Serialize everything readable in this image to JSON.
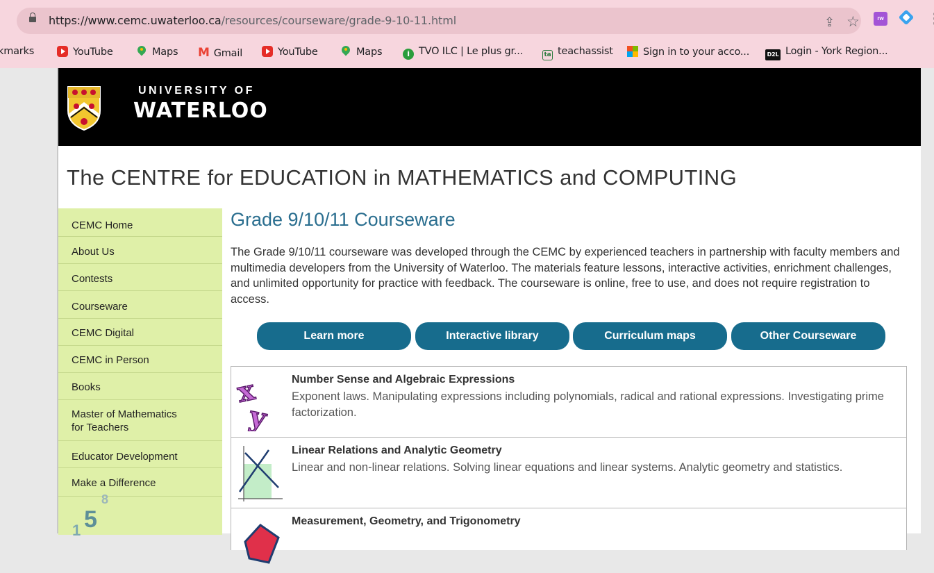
{
  "browser": {
    "url_main": "https://www.cemc.uwaterloo.ca",
    "url_rest": "/resources/courseware/grade-9-10-11.html",
    "bookmarks": [
      {
        "label": "kmarks",
        "icon": "none"
      },
      {
        "label": "YouTube",
        "icon": "youtube-icon"
      },
      {
        "label": "Maps",
        "icon": "maps-icon"
      },
      {
        "label": "Gmail",
        "icon": "gmail-icon"
      },
      {
        "label": "YouTube",
        "icon": "youtube-icon"
      },
      {
        "label": "Maps",
        "icon": "maps-icon"
      },
      {
        "label": "TVO ILC | Le plus gr...",
        "icon": "tvo-icon"
      },
      {
        "label": "teachassist",
        "icon": "teachassist-icon"
      },
      {
        "label": "Sign in to your acco...",
        "icon": "microsoft-icon"
      },
      {
        "label": "Login - York Region...",
        "icon": "d2l-icon"
      }
    ],
    "icons": {
      "gmail_glyph": "M",
      "tvo_glyph": "i",
      "ta_glyph": "ta",
      "d2l_glyph": "D2L",
      "ext_glyph": "rw"
    }
  },
  "banner": {
    "university_of": "UNIVERSITY OF",
    "waterloo": "WATERLOO"
  },
  "site_title": "The CENTRE for EDUCATION in MATHEMATICS and COMPUTING",
  "sidebar": {
    "items": [
      {
        "label": "CEMC Home"
      },
      {
        "label": "About Us"
      },
      {
        "label": "Contests"
      },
      {
        "label": "Courseware"
      },
      {
        "label": "CEMC Digital"
      },
      {
        "label": "CEMC in Person"
      },
      {
        "label": "Books"
      },
      {
        "label": "Master of Mathematics\nfor Teachers"
      },
      {
        "label": "Educator Development"
      },
      {
        "label": "Make a Difference"
      }
    ]
  },
  "main": {
    "title": "Grade 9/10/11 Courseware",
    "intro": "The Grade 9/10/11 courseware was developed through the CEMC by experienced teachers in partnership with faculty members and multimedia developers from the University of Waterloo. The materials feature lessons, interactive activities, enrichment challenges, and unlimited opportunity for practice with feedback. The courseware is online, free to use, and does not require registration to access.",
    "buttons": [
      {
        "label": "Learn more"
      },
      {
        "label": "Interactive library"
      },
      {
        "label": "Curriculum maps"
      },
      {
        "label": "Other Courseware"
      }
    ],
    "sections": [
      {
        "title": "Number Sense and Algebraic Expressions",
        "desc": "Exponent laws. Manipulating expressions including polynomials, radical and rational expressions. Investigating prime factorization."
      },
      {
        "title": "Linear Relations and Analytic Geometry",
        "desc": "Linear and non-linear relations. Solving linear equations and linear systems. Analytic geometry and statistics."
      },
      {
        "title": "Measurement, Geometry, and Trigonometry",
        "desc": ""
      }
    ]
  },
  "decor": {
    "numbers": [
      "1",
      "5",
      "8"
    ],
    "xy": [
      "x",
      "y"
    ]
  },
  "colors": {
    "accent": "#176c8d",
    "sidebar": "#dff0a8",
    "title": "#2a6e8f"
  }
}
